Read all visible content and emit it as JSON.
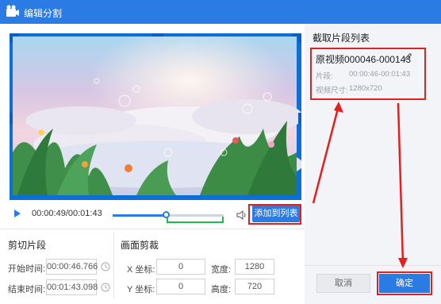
{
  "window": {
    "title": "编辑分割"
  },
  "player": {
    "time_display": "00:00:49/00:01:43",
    "progress": 0.48,
    "add_to_list_label": "添加到列表"
  },
  "cut": {
    "title": "剪切片段",
    "start_label": "开始时间:",
    "start_value": "00:00:46.766",
    "end_label": "结束时间:",
    "end_value": "00:01:43.098"
  },
  "crop": {
    "title": "画面剪裁",
    "x_label": "X 坐标:",
    "x_value": "0",
    "y_label": "Y 坐标:",
    "y_value": "0",
    "width_label": "宽度:",
    "width_value": "1280",
    "height_label": "高度:",
    "height_value": "720"
  },
  "clip_list": {
    "title": "截取片段列表",
    "items": [
      {
        "name": "原视频000046-000143",
        "segment_label": "片段:",
        "segment_value": "00:00:46-00:01:43",
        "size_label": "视频尺寸:",
        "size_value": "1280x720"
      }
    ]
  },
  "footer": {
    "cancel_label": "取消",
    "ok_label": "确定"
  },
  "colors": {
    "accent": "#2a7be4",
    "highlight": "#e61e1e",
    "range": "#1fb84a"
  }
}
